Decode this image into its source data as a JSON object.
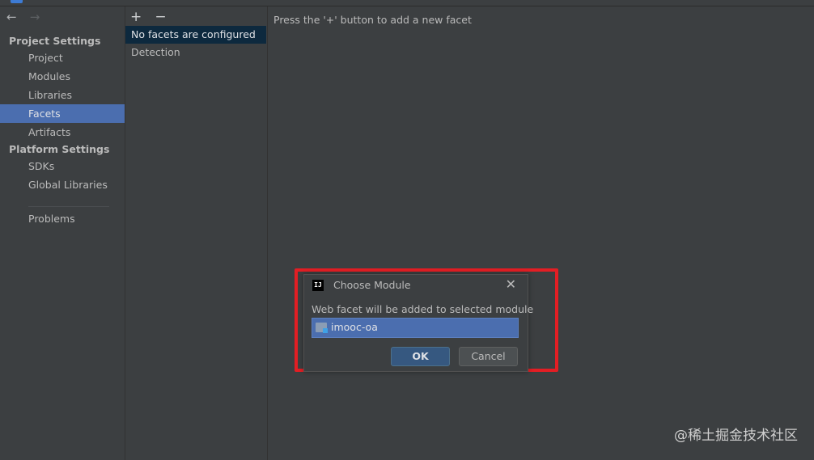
{
  "sidebar": {
    "project_settings_heading": "Project Settings",
    "items_project": [
      "Project",
      "Modules",
      "Libraries",
      "Facets",
      "Artifacts"
    ],
    "platform_settings_heading": "Platform Settings",
    "items_platform": [
      "SDKs",
      "Global Libraries"
    ],
    "problems": "Problems",
    "selected": "Facets"
  },
  "nav": {
    "back_icon": "←",
    "forward_icon": "→"
  },
  "toolbar": {
    "add_icon": "+",
    "remove_icon": "−"
  },
  "middle": {
    "items": [
      "No facets are configured",
      "Detection"
    ]
  },
  "main": {
    "hint": "Press the '+' button to add a new facet"
  },
  "dialog": {
    "icon_text": "IJ",
    "title": "Choose Module",
    "close_icon": "✕",
    "message": "Web facet will be added to selected module",
    "module": "imooc-oa",
    "ok_label": "OK",
    "cancel_label": "Cancel"
  },
  "watermark": "@稀土掘金技术社区",
  "colors": {
    "background": "#3c3f41",
    "selection": "#4b6eaf",
    "highlight_border": "#e31e24",
    "ok_button": "#365880"
  }
}
